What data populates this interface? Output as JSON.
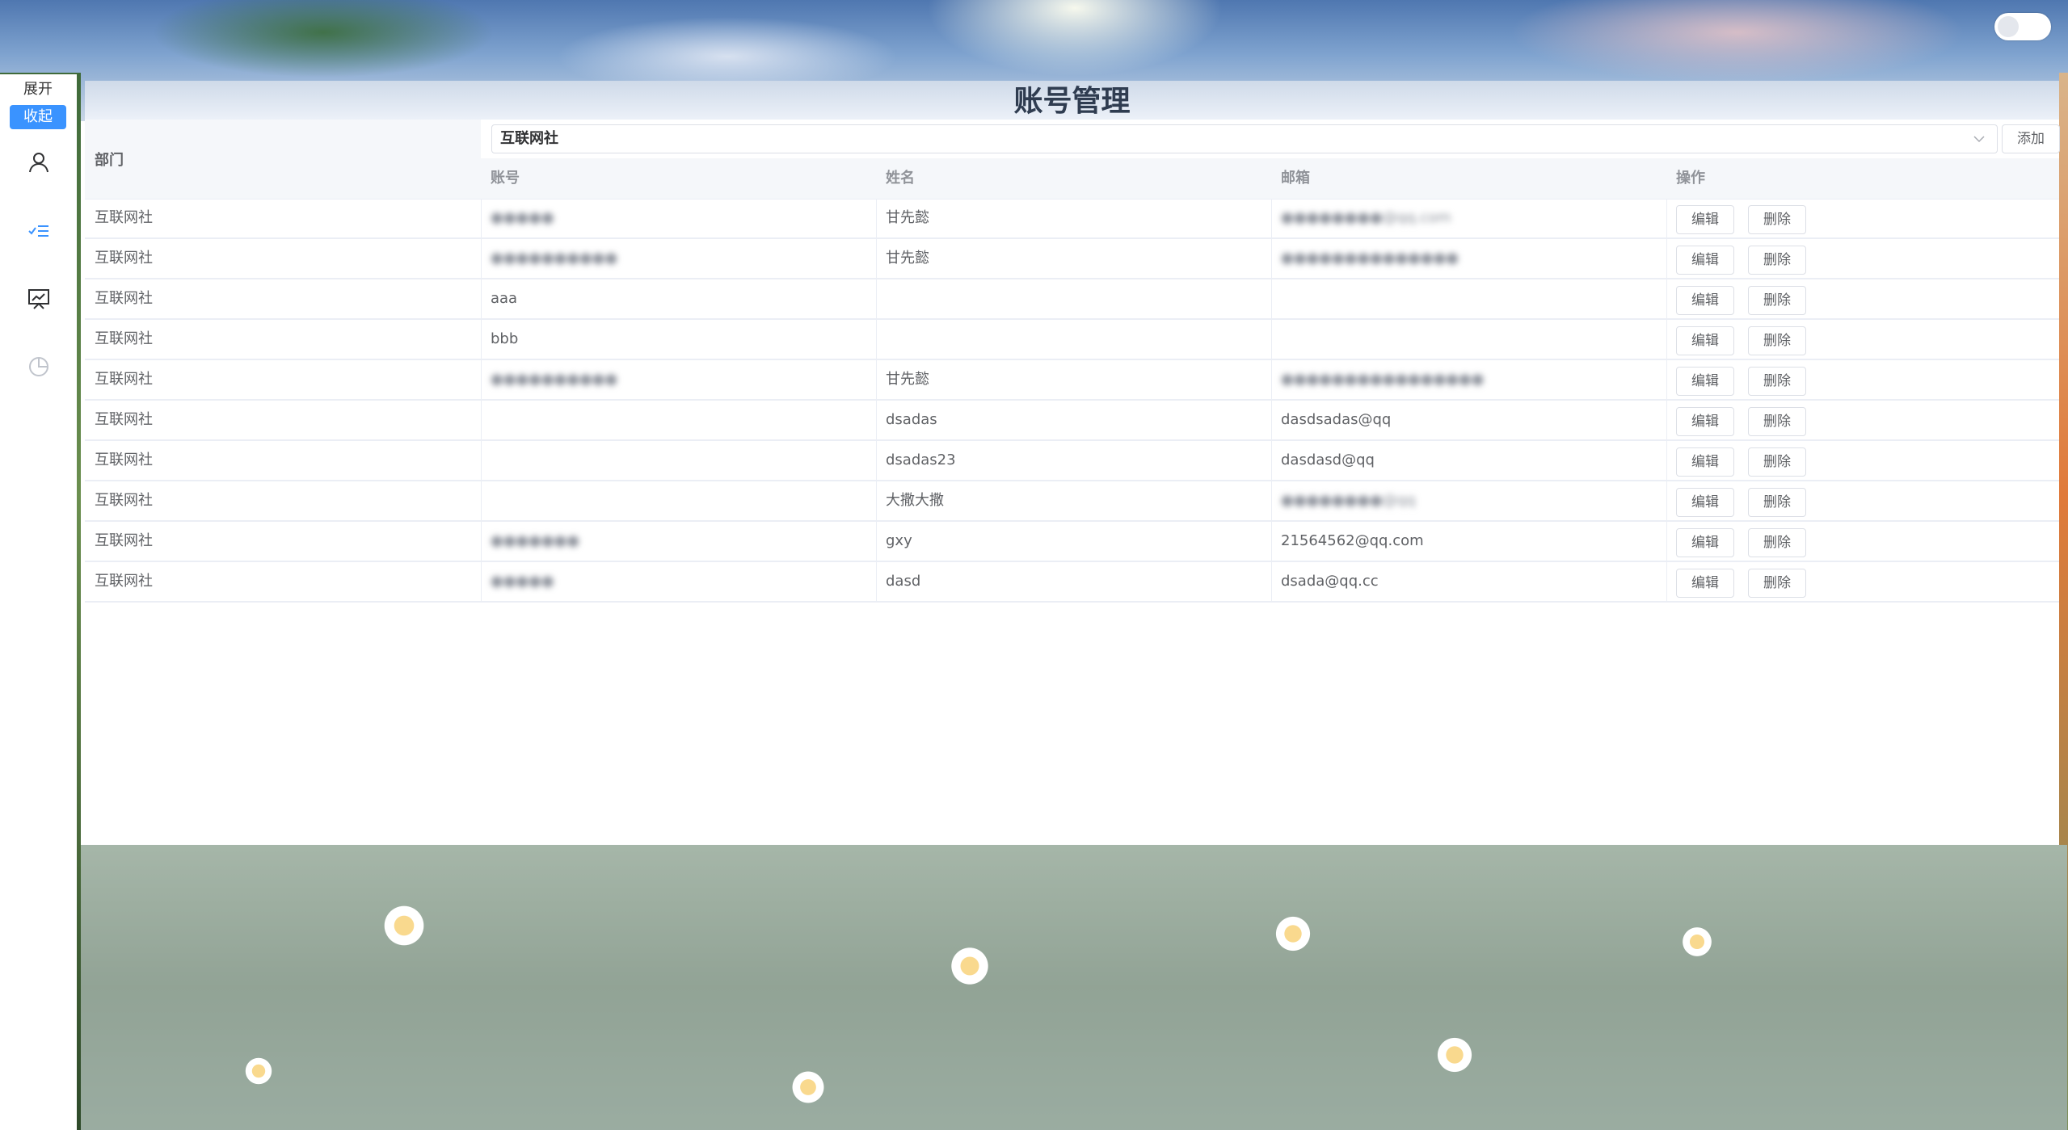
{
  "sidebar": {
    "expand_label": "展开",
    "collapse_label": "收起",
    "nav_icons": [
      "user-icon",
      "list-check-icon",
      "presentation-chart-icon",
      "pie-chart-icon"
    ],
    "active_color": "#3a93ff"
  },
  "theme_toggle": {
    "state": "off"
  },
  "page": {
    "title": "账号管理",
    "department_label": "部门",
    "department_selected": "互联网社",
    "add_label": "添加"
  },
  "table": {
    "columns": [
      "账号",
      "姓名",
      "邮箱",
      "操作"
    ],
    "edit_label": "编辑",
    "delete_label": "删除",
    "rows": [
      {
        "dept": "互联网社",
        "account": "●●●●●",
        "account_blurred": true,
        "name": "甘先懿",
        "email": "●●●●●●●●@qq.com",
        "email_blurred": true
      },
      {
        "dept": "互联网社",
        "account": "●●●●●●●●●●",
        "account_blurred": true,
        "name": "甘先懿",
        "email": "●●●●●●●●●●●●●●",
        "email_blurred": true
      },
      {
        "dept": "互联网社",
        "account": "aaa",
        "account_blurred": false,
        "name": "",
        "email": "",
        "email_blurred": false
      },
      {
        "dept": "互联网社",
        "account": "bbb",
        "account_blurred": false,
        "name": "",
        "email": "",
        "email_blurred": false
      },
      {
        "dept": "互联网社",
        "account": "●●●●●●●●●●",
        "account_blurred": true,
        "name": "甘先懿",
        "email": "●●●●●●●●●●●●●●●●",
        "email_blurred": true
      },
      {
        "dept": "互联网社",
        "account": "",
        "account_blurred": false,
        "name": "dsadas",
        "email": "dasdsadas@qq",
        "email_blurred": false
      },
      {
        "dept": "互联网社",
        "account": "",
        "account_blurred": false,
        "name": "dsadas23",
        "email": "dasdasd@qq",
        "email_blurred": false
      },
      {
        "dept": "互联网社",
        "account": "",
        "account_blurred": false,
        "name": "大撒大撒",
        "email": "●●●●●●●●@qq",
        "email_blurred": true
      },
      {
        "dept": "互联网社",
        "account": "●●●●●●●",
        "account_blurred": true,
        "name": "gxy",
        "email": "21564562@qq.com",
        "email_blurred": false
      },
      {
        "dept": "互联网社",
        "account": "●●●●●",
        "account_blurred": true,
        "name": "dasd",
        "email": "dsada@qq.cc",
        "email_blurred": false
      }
    ]
  }
}
